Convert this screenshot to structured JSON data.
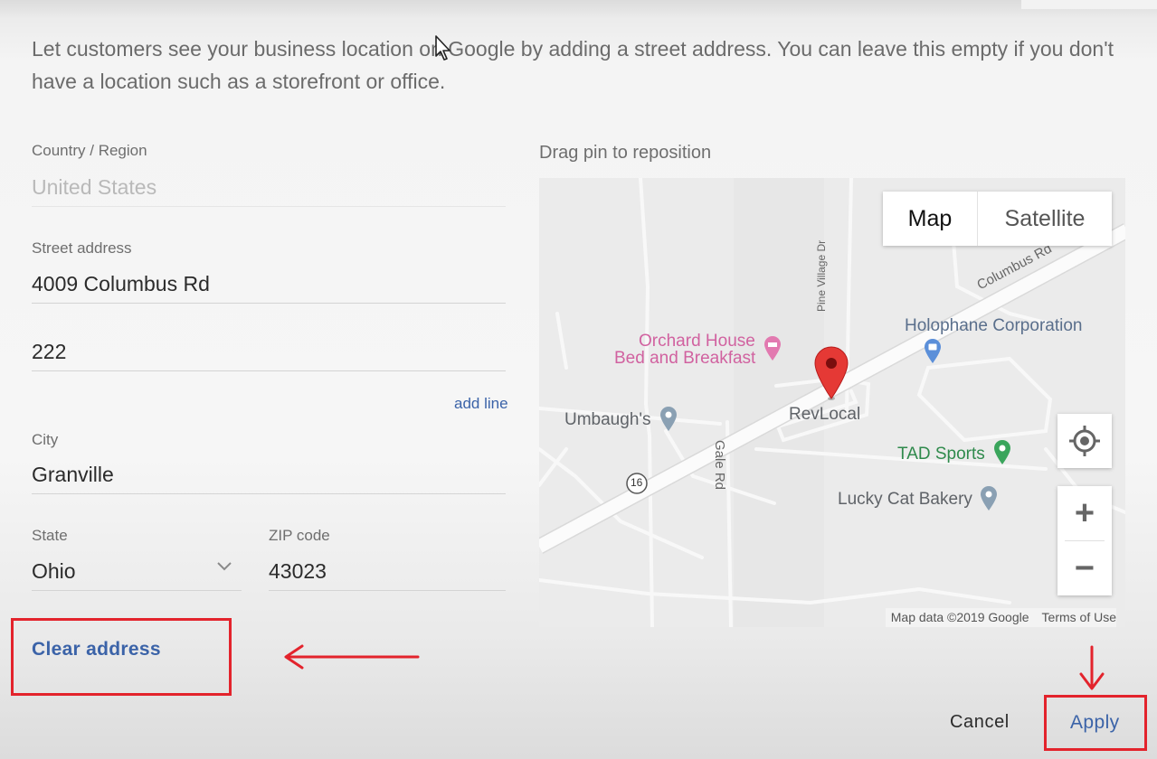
{
  "intro_text": "Let customers see your business location on Google by adding a street address. You can leave this empty if you don't have a location such as a storefront or office.",
  "form": {
    "country": {
      "label": "Country / Region",
      "value": "United States"
    },
    "street": {
      "label": "Street address",
      "value": "4009 Columbus Rd"
    },
    "street2": {
      "value": "222"
    },
    "add_line": "add line",
    "city": {
      "label": "City",
      "value": "Granville"
    },
    "state": {
      "label": "State",
      "value": "Ohio"
    },
    "zip": {
      "label": "ZIP code",
      "value": "43023"
    },
    "clear_address": "Clear address"
  },
  "map": {
    "hint": "Drag pin to reposition",
    "toggle": {
      "map": "Map",
      "satellite": "Satellite",
      "selected": "Map"
    },
    "places": {
      "holophane": "Holophane Corporation",
      "orchard_line1": "Orchard House",
      "orchard_line2": "Bed and Breakfast",
      "revlocal": "RevLocal",
      "umbaughs": "Umbaugh's",
      "tad_sports": "TAD Sports",
      "lucky_cat": "Lucky Cat Bakery"
    },
    "roads": {
      "columbus_rd": "Columbus Rd",
      "pine_village": "Pine Village Dr",
      "gale_rd": "Gale Rd",
      "route": "16"
    },
    "zoom_in": "+",
    "zoom_out": "−",
    "attribution": "Map data ©2019 Google",
    "terms": "Terms of Use"
  },
  "actions": {
    "cancel": "Cancel",
    "apply": "Apply"
  },
  "colors": {
    "link_blue": "#3b63a8",
    "annotation_red": "#e3232c",
    "pin_red": "#e53935"
  }
}
